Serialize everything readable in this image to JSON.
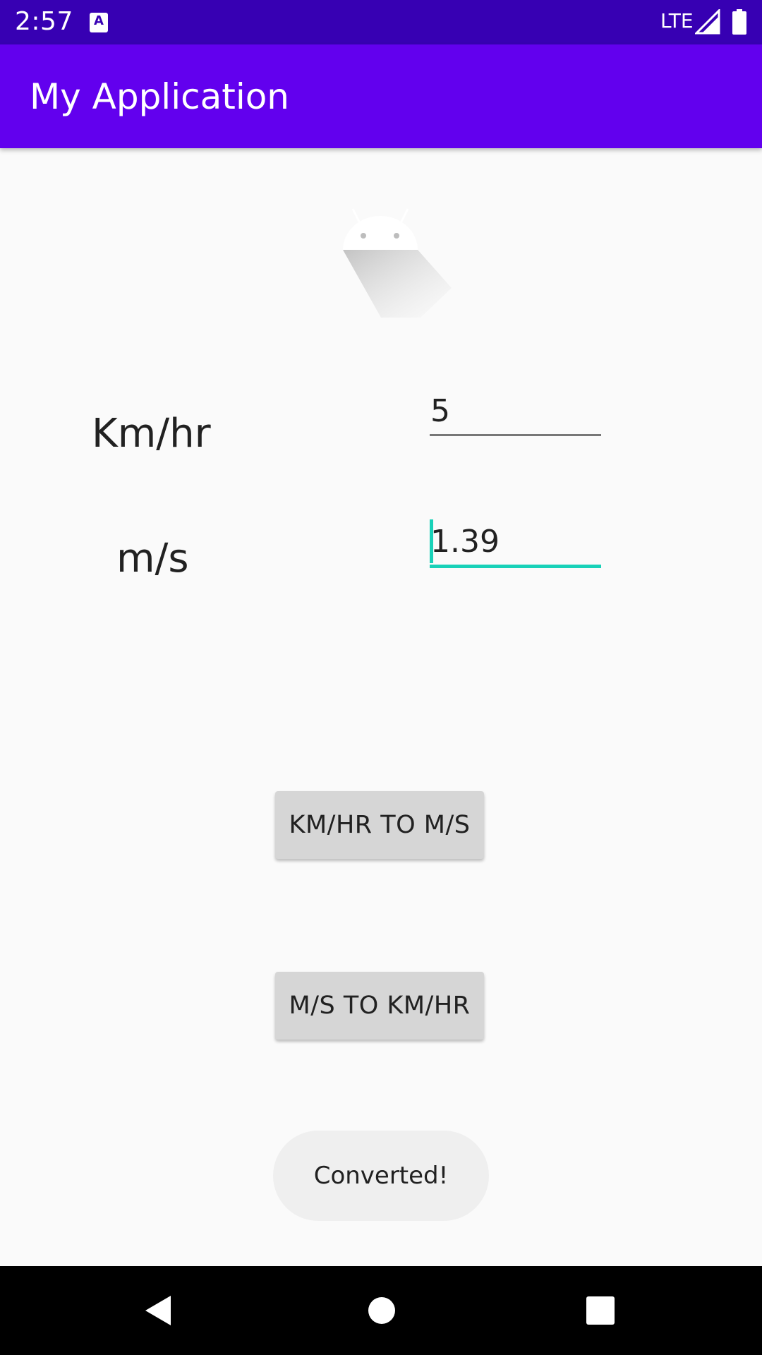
{
  "status_bar": {
    "time": "2:57",
    "notification_glyph": "A",
    "network": "LTE",
    "signal_icon": "signal-icon",
    "battery_icon": "battery-icon"
  },
  "app_bar": {
    "title": "My Application"
  },
  "colors": {
    "status_bar": "#3700b3",
    "app_bar": "#6200ee",
    "accent": "#18d1b8",
    "background": "#fafafa",
    "button": "#d6d6d6"
  },
  "converter": {
    "kmhr_label": "Km/hr",
    "kmhr_value": "5",
    "ms_label": "m/s",
    "ms_value": "1.39"
  },
  "buttons": {
    "kmhr_to_ms": "KM/HR TO M/S",
    "ms_to_kmhr": "M/S TO KM/HR"
  },
  "toast": {
    "message": "Converted!"
  },
  "nav_bar": {
    "icons": [
      "back-icon",
      "home-icon",
      "recents-icon"
    ]
  }
}
